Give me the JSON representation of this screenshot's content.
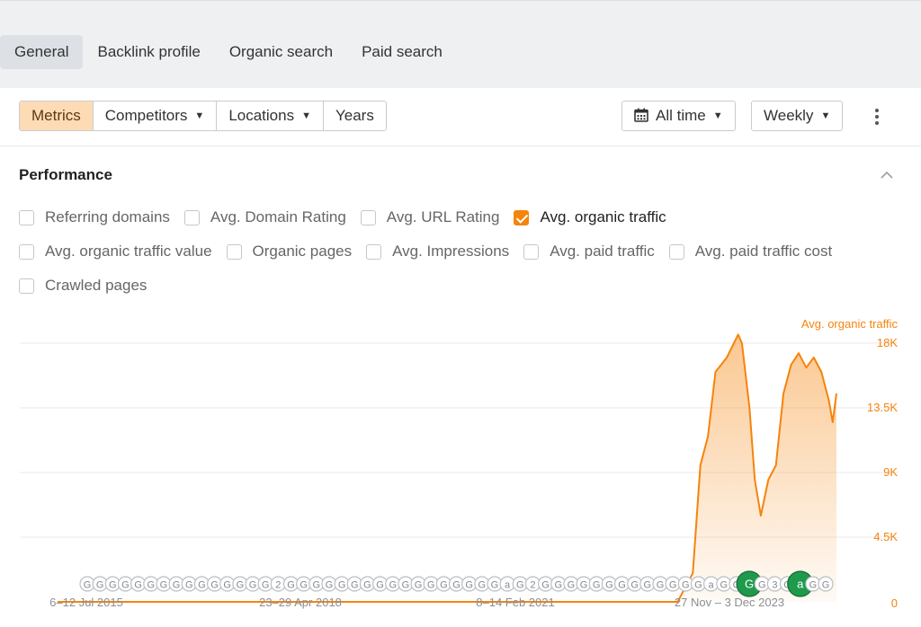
{
  "tabs": [
    {
      "label": "General",
      "active": true
    },
    {
      "label": "Backlink profile",
      "active": false
    },
    {
      "label": "Organic search",
      "active": false
    },
    {
      "label": "Paid search",
      "active": false
    }
  ],
  "toolbar": {
    "segments": [
      {
        "label": "Metrics",
        "active": true,
        "dropdown": false
      },
      {
        "label": "Competitors",
        "active": false,
        "dropdown": true
      },
      {
        "label": "Locations",
        "active": false,
        "dropdown": true
      },
      {
        "label": "Years",
        "active": false,
        "dropdown": false
      }
    ],
    "date_range": "All time",
    "interval": "Weekly",
    "date_icon": "calendar-icon",
    "more_icon": "kebab-menu-icon"
  },
  "performance": {
    "title": "Performance",
    "collapse_icon": "chevron-up-icon",
    "metrics": [
      {
        "label": "Referring domains",
        "checked": false
      },
      {
        "label": "Avg. Domain Rating",
        "checked": false
      },
      {
        "label": "Avg. URL Rating",
        "checked": false
      },
      {
        "label": "Avg. organic traffic",
        "checked": true
      },
      {
        "label": "Avg. organic traffic value",
        "checked": false
      },
      {
        "label": "Organic pages",
        "checked": false
      },
      {
        "label": "Avg. Impressions",
        "checked": false
      },
      {
        "label": "Avg. paid traffic",
        "checked": false
      },
      {
        "label": "Avg. paid traffic cost",
        "checked": false
      },
      {
        "label": "Crawled pages",
        "checked": false
      }
    ]
  },
  "colors": {
    "accent": "#f5840c",
    "active_segment": "#fddcb5",
    "update_marker": "#1f9a4d"
  },
  "chart_data": {
    "type": "area",
    "ylabel": "Avg. organic traffic",
    "ylim": [
      0,
      18000
    ],
    "y_ticks": [
      "0",
      "4.5K",
      "9K",
      "13.5K",
      "18K"
    ],
    "x_tick_labels": [
      "6–12 Jul 2015",
      "23–29 Apr 2018",
      "8–14 Feb 2021",
      "27 Nov – 3 Dec 2023"
    ],
    "grid": true,
    "series": [
      {
        "values": [
          [
            2015.5,
            0
          ],
          [
            2023.1,
            0
          ],
          [
            2023.7,
            0
          ],
          [
            2023.9,
            2000
          ],
          [
            2024.0,
            9500
          ],
          [
            2024.1,
            11500
          ],
          [
            2024.2,
            16000
          ],
          [
            2024.35,
            17000
          ],
          [
            2024.5,
            18600
          ],
          [
            2024.55,
            18000
          ],
          [
            2024.65,
            13500
          ],
          [
            2024.72,
            8500
          ],
          [
            2024.8,
            6000
          ],
          [
            2024.9,
            8500
          ],
          [
            2025.0,
            9500
          ],
          [
            2025.1,
            14500
          ],
          [
            2025.2,
            16500
          ],
          [
            2025.3,
            17300
          ],
          [
            2025.4,
            16300
          ],
          [
            2025.5,
            17000
          ],
          [
            2025.6,
            16000
          ],
          [
            2025.7,
            14000
          ],
          [
            2025.75,
            12500
          ],
          [
            2025.8,
            14500
          ]
        ]
      }
    ],
    "update_markers": [
      "G",
      "G",
      "G",
      "G",
      "G",
      "G",
      "G",
      "G",
      "G",
      "G",
      "G",
      "G",
      "G",
      "G",
      "G",
      "2",
      "G",
      "G",
      "G",
      "G",
      "G",
      "G",
      "G",
      "G",
      "G",
      "G",
      "G",
      "G",
      "G",
      "G",
      "G",
      "G",
      "G",
      "a",
      "G",
      "2",
      "G",
      "G",
      "G",
      "G",
      "G",
      "G",
      "G",
      "G",
      "G",
      "G",
      "G",
      "G",
      "G",
      "a",
      "G",
      "G",
      "G",
      "G",
      "3",
      "G",
      "a",
      "G",
      "G"
    ]
  }
}
